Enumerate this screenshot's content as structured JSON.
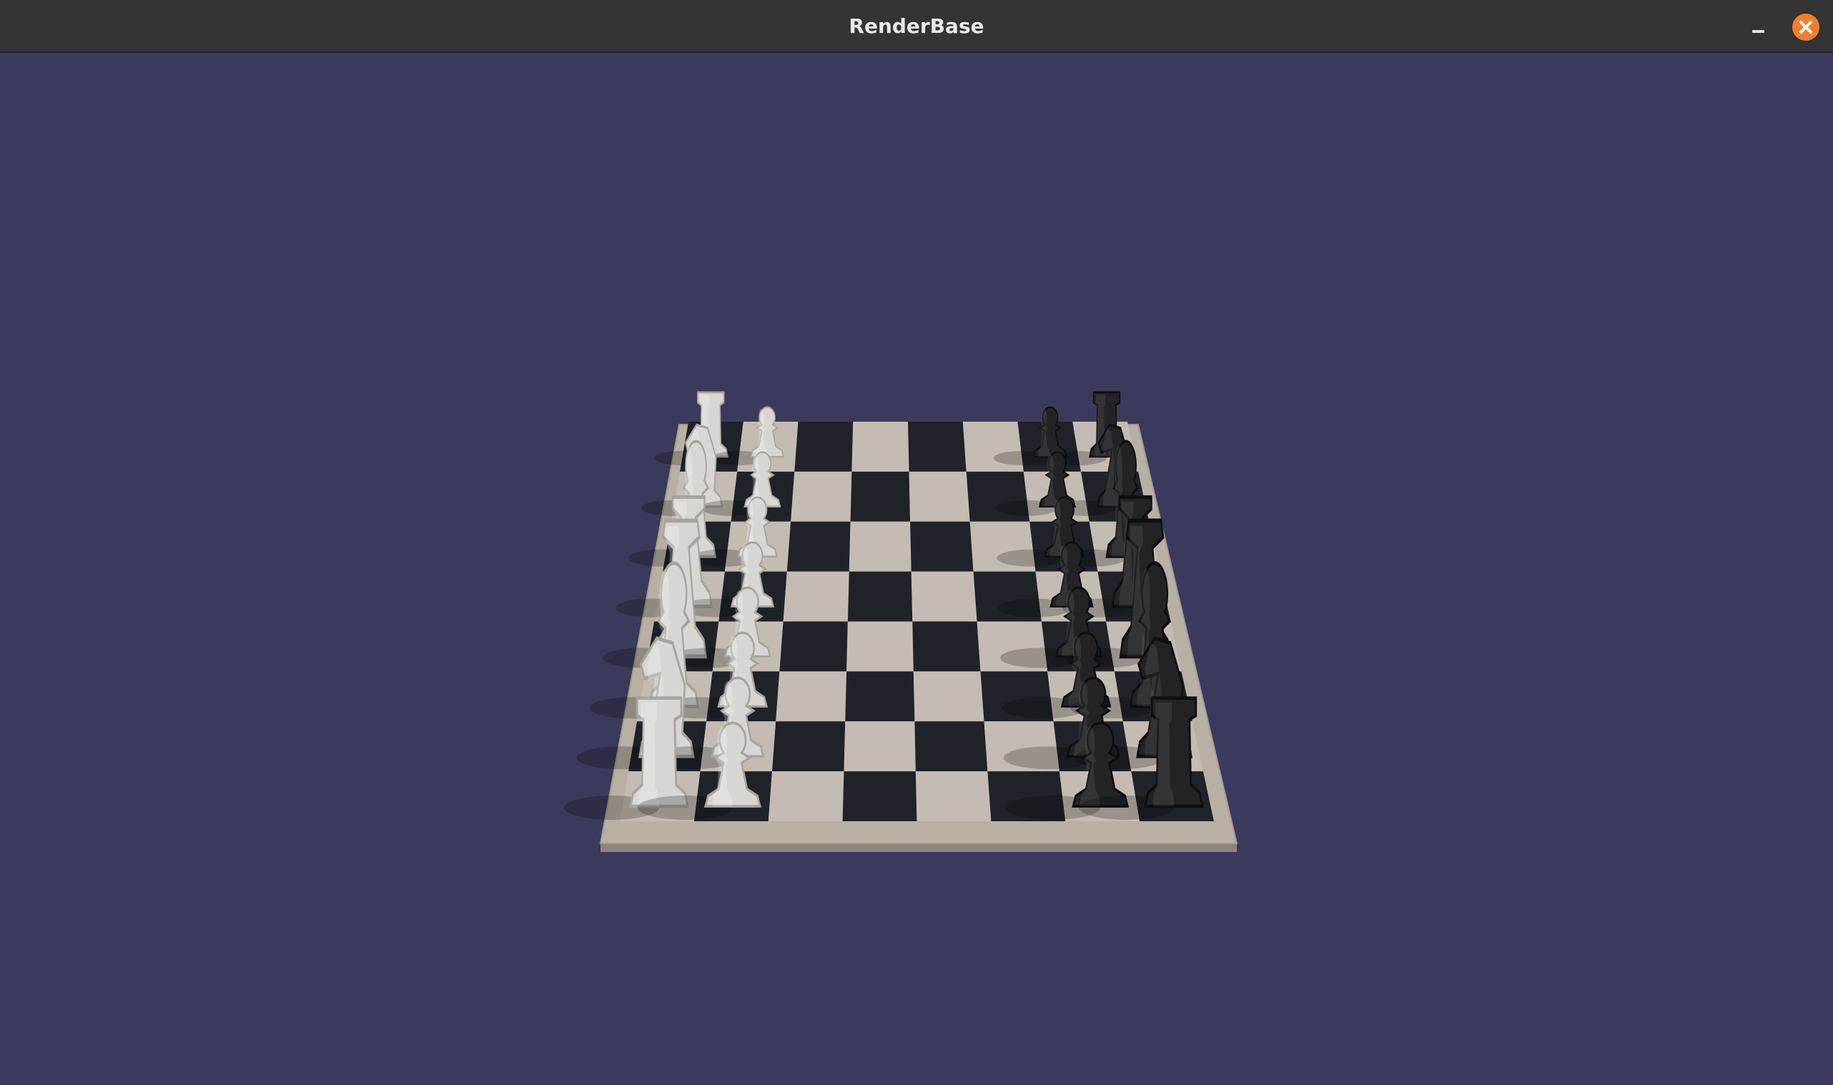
{
  "window": {
    "title": "RenderBase"
  },
  "scene": {
    "background_color": "#3a3a5c",
    "board": {
      "ranks": 8,
      "files": 8,
      "light_square_color": "#c4bcb2",
      "dark_square_color": "#202229",
      "frame_color": "#b9b0a4"
    },
    "pieces": {
      "white": [
        "rook",
        "knight",
        "bishop",
        "queen",
        "king",
        "bishop",
        "knight",
        "rook",
        "pawn",
        "pawn",
        "pawn",
        "pawn",
        "pawn",
        "pawn",
        "pawn",
        "pawn"
      ],
      "black": [
        "rook",
        "knight",
        "bishop",
        "queen",
        "king",
        "bishop",
        "knight",
        "rook",
        "pawn",
        "pawn",
        "pawn",
        "pawn",
        "pawn",
        "pawn",
        "pawn",
        "pawn"
      ],
      "white_color": "#d8d6d2",
      "black_color": "#232326"
    }
  },
  "controls": {
    "minimize_icon": "minimize-icon",
    "close_icon": "close-icon",
    "close_color": "#f07f2c"
  }
}
